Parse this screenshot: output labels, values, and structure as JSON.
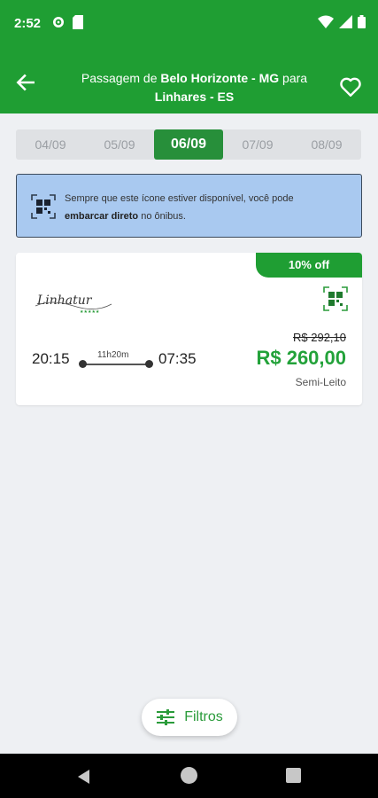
{
  "status_bar": {
    "time": "2:52",
    "icons_left": [
      "settings-icon",
      "sim-card-icon"
    ],
    "icons_right": [
      "wifi-icon",
      "signal-icon",
      "battery-icon"
    ]
  },
  "app_bar": {
    "title_prefix": "Passagem de ",
    "origin": "Belo Horizonte - MG",
    "connector": " para",
    "destination": "Linhares - ES",
    "icons": [
      "back-arrow-icon",
      "heart-icon"
    ]
  },
  "date_tabs": [
    {
      "label": "04/09",
      "active": false
    },
    {
      "label": "05/09",
      "active": false
    },
    {
      "label": "06/09",
      "active": true
    },
    {
      "label": "07/09",
      "active": false
    },
    {
      "label": "08/09",
      "active": false
    }
  ],
  "info_banner": {
    "icon": "qr-code-icon",
    "text_1": "Sempre que este ícone estiver disponível, você pode",
    "text_bold": "embarcar direto",
    "text_2": " no ônibus."
  },
  "trip_card": {
    "discount": "10% off",
    "company_logo_text": "Linhatur",
    "departure": "20:15",
    "arrival": "07:35",
    "duration": "11h20m",
    "old_price": "R$ 292,10",
    "price": "R$ 260,00",
    "seat_type": "Semi-Leito"
  },
  "filter_button": {
    "label": "Filtros",
    "icon": "sliders-icon"
  },
  "colors": {
    "primary_green": "#1f9e33",
    "price_green": "#23a23a",
    "banner_blue": "#a9c9f0"
  }
}
